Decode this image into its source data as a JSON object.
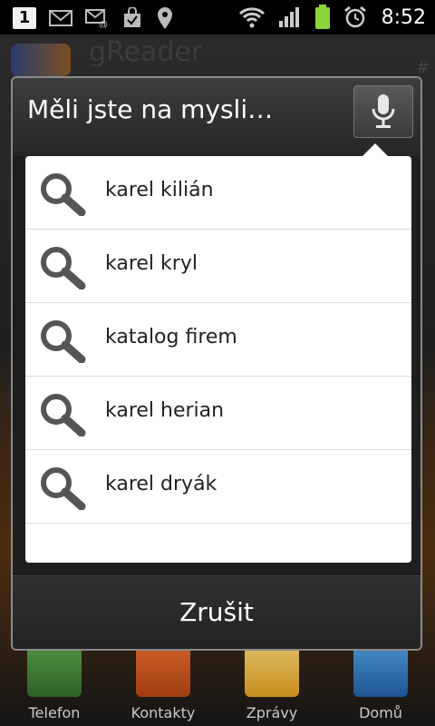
{
  "status_bar": {
    "notification_count": "1",
    "time": "8:52"
  },
  "background_app": {
    "title": "gReader",
    "hash": "#",
    "dock": [
      {
        "label": "Telefon"
      },
      {
        "label": "Kontakty"
      },
      {
        "label": "Zprávy"
      },
      {
        "label": "Domů"
      }
    ]
  },
  "dialog": {
    "title": "Měli jste na mysli…",
    "suggestions": [
      {
        "text": "karel kilián"
      },
      {
        "text": "karel kryl"
      },
      {
        "text": "katalog firem"
      },
      {
        "text": "karel herian"
      },
      {
        "text": "karel dryák"
      }
    ],
    "cancel_label": "Zrušit"
  },
  "colors": {
    "dialog_bg": "#1e1e1e",
    "list_bg": "#ffffff",
    "battery": "#8bd43a"
  }
}
